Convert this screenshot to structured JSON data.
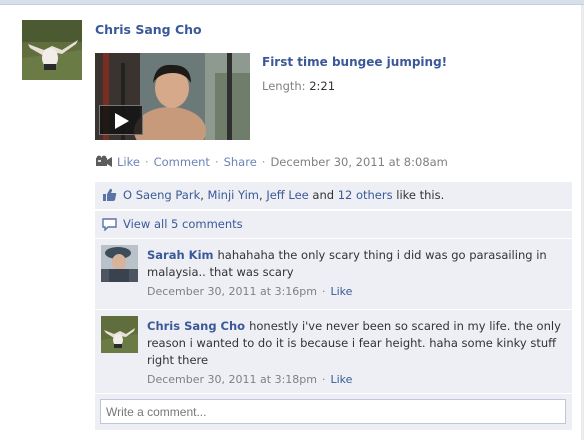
{
  "post": {
    "author": "Chris Sang Cho",
    "video": {
      "title": "First time bungee jumping!",
      "length_label": "Length:",
      "length_value": "2:21"
    },
    "actions": {
      "like": "Like",
      "comment": "Comment",
      "share": "Share",
      "timestamp": "December 30, 2011 at 8:08am"
    }
  },
  "likes": {
    "names": [
      "O Saeng Park",
      "Minji Yim",
      "Jeff Lee"
    ],
    "separator": ",",
    "and_text": "and",
    "others_link": "12 others",
    "suffix": "like this."
  },
  "view_all": "View all 5 comments",
  "comments": [
    {
      "author": "Sarah Kim",
      "text": "hahahaha the only scary thing i did was go parasailing in malaysia.. that was scary",
      "timestamp": "December 30, 2011 at 3:16pm",
      "like": "Like"
    },
    {
      "author": "Chris Sang Cho",
      "text": "honestly i've never been so scared in my life. the only reason i wanted to do it is because i fear height. haha some kinky stuff right there",
      "timestamp": "December 30, 2011 at 3:18pm",
      "like": "Like"
    }
  ],
  "write_comment": {
    "placeholder": "Write a comment..."
  },
  "colors": {
    "link": "#3b5998",
    "panel": "#edeff4",
    "muted": "#808080"
  }
}
